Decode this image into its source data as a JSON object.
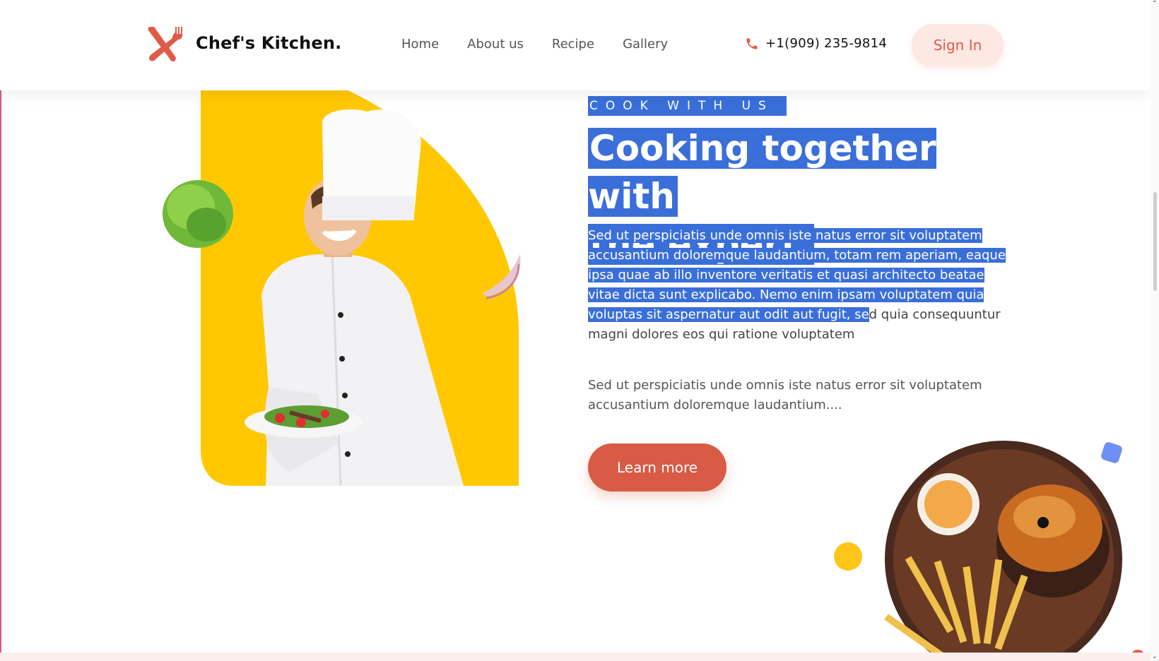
{
  "header": {
    "brand": "Chef's Kitchen.",
    "nav": [
      "Home",
      "About us",
      "Recipe",
      "Gallery"
    ],
    "phone": "+1(909) 235-9814",
    "signin": "Sign In"
  },
  "hero": {
    "eyebrow": "COOK WITH US",
    "heading_line1": "Cooking together with",
    "heading_line2": "the expert.",
    "para1_selected": "Sed ut perspiciatis unde omnis iste natus error sit voluptatem accusantium doloremque laudantium, totam rem aperiam, eaque ipsa quae ab illo inventore veritatis et quasi architecto beatae vitae dicta sunt explicabo. Nemo enim ipsam voluptatem quia voluptas sit aspernatur aut odit aut fugit, se",
    "para1_rest": "d quia consequuntur magni dolores eos qui ratione voluptatem",
    "para2": "Sed ut perspiciatis unde omnis iste natus error sit voluptatem accusantium doloremque laudantium....",
    "cta": "Learn more"
  },
  "colors": {
    "accent": "#d95a45",
    "selection": "#3a6fd9",
    "yellow": "#ffc61a"
  },
  "icons": [
    "knife-fork-logo-icon",
    "phone-icon",
    "scroll-up-icon",
    "scroll-down-icon"
  ]
}
